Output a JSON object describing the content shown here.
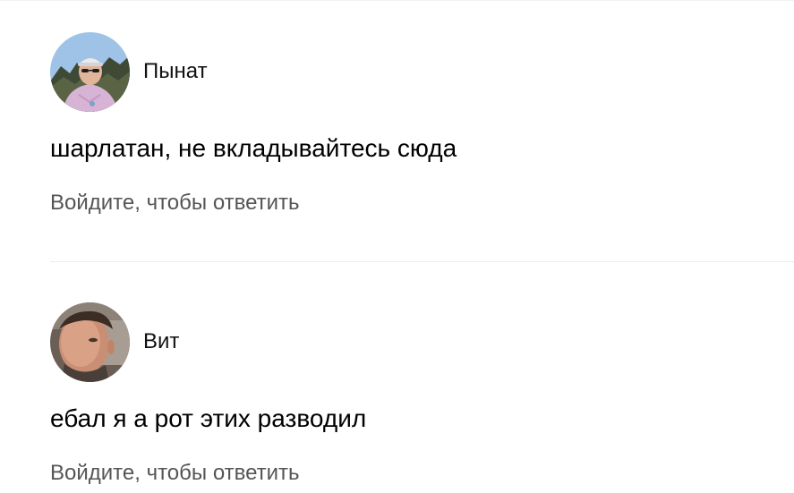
{
  "comments": [
    {
      "author": "Пынат",
      "text": "шарлатан, не вкладывайтесь сюда",
      "reply_label": "Войдите, чтобы ответить"
    },
    {
      "author": "Вит",
      "text": "ебал я а рот этих разводил",
      "reply_label": "Войдите, чтобы ответить"
    }
  ],
  "colors": {
    "text": "#000000",
    "muted": "#555555",
    "separator": "#ededed"
  }
}
